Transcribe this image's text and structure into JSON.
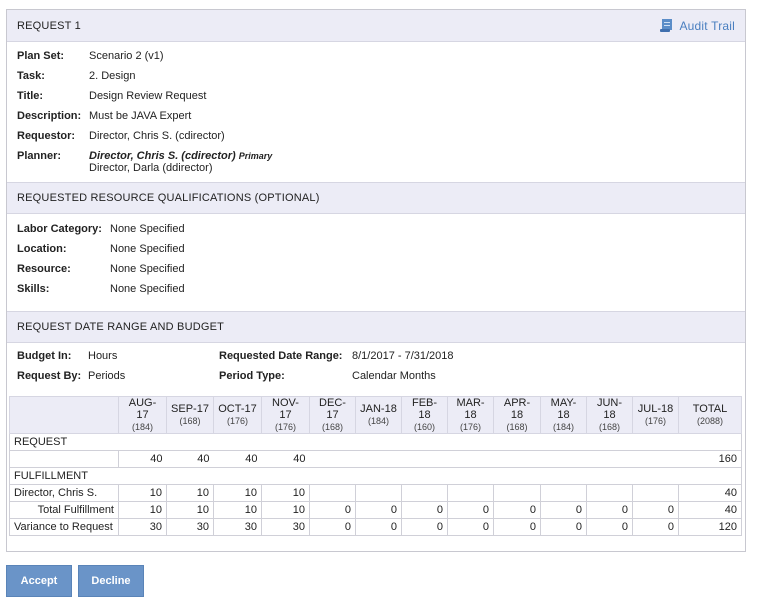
{
  "request": {
    "title": "REQUEST 1",
    "audit_trail": "Audit Trail",
    "fields": [
      {
        "label": "Plan Set:",
        "value": "Scenario 2 (v1)"
      },
      {
        "label": "Task:",
        "value": "2. Design"
      },
      {
        "label": "Title:",
        "value": "Design Review Request"
      },
      {
        "label": "Description:",
        "value": "Must be JAVA Expert"
      },
      {
        "label": "Requestor:",
        "value": "Director, Chris S. (cdirector)"
      }
    ],
    "planner": {
      "label": "Planner:",
      "primary_name": "Director, Chris S. (cdirector)",
      "primary_tag": "Primary",
      "secondary_name": "Director, Darla (ddirector)"
    }
  },
  "qualifications": {
    "title": "REQUESTED RESOURCE QUALIFICATIONS (OPTIONAL)",
    "fields": [
      {
        "label": "Labor Category:",
        "value": "None Specified"
      },
      {
        "label": "Location:",
        "value": "None Specified"
      },
      {
        "label": "Resource:",
        "value": "None Specified"
      },
      {
        "label": "Skills:",
        "value": "None Specified"
      }
    ]
  },
  "budget": {
    "title": "REQUEST DATE RANGE AND BUDGET",
    "budget_in_label": "Budget In:",
    "budget_in_value": "Hours",
    "request_by_label": "Request By:",
    "request_by_value": "Periods",
    "date_range_label": "Requested Date Range:",
    "date_range_value": "8/1/2017 - 7/31/2018",
    "period_type_label": "Period Type:",
    "period_type_value": "Calendar Months"
  },
  "grid": {
    "columns": [
      {
        "month": "AUG-17",
        "hours": "(184)"
      },
      {
        "month": "SEP-17",
        "hours": "(168)"
      },
      {
        "month": "OCT-17",
        "hours": "(176)"
      },
      {
        "month": "NOV-17",
        "hours": "(176)"
      },
      {
        "month": "DEC-17",
        "hours": "(168)"
      },
      {
        "month": "JAN-18",
        "hours": "(184)"
      },
      {
        "month": "FEB-18",
        "hours": "(160)"
      },
      {
        "month": "MAR-18",
        "hours": "(176)"
      },
      {
        "month": "APR-18",
        "hours": "(168)"
      },
      {
        "month": "MAY-18",
        "hours": "(184)"
      },
      {
        "month": "JUN-18",
        "hours": "(168)"
      },
      {
        "month": "JUL-18",
        "hours": "(176)"
      },
      {
        "month": "TOTAL",
        "hours": "(2088)"
      }
    ],
    "request_section": "REQUEST",
    "request_values": [
      "40",
      "40",
      "40",
      "40",
      "",
      "",
      "",
      "",
      "",
      "",
      "",
      "",
      "160"
    ],
    "fulfillment_section": "FULFILLMENT",
    "rows": [
      {
        "label": "Director, Chris S.",
        "values": [
          "10",
          "10",
          "10",
          "10",
          "",
          "",
          "",
          "",
          "",
          "",
          "",
          "",
          "40"
        ]
      },
      {
        "label": "Total Fulfillment",
        "values": [
          "10",
          "10",
          "10",
          "10",
          "0",
          "0",
          "0",
          "0",
          "0",
          "0",
          "0",
          "0",
          "40"
        ]
      },
      {
        "label": "Variance to Request",
        "values": [
          "30",
          "30",
          "30",
          "30",
          "0",
          "0",
          "0",
          "0",
          "0",
          "0",
          "0",
          "0",
          "120"
        ]
      }
    ]
  },
  "actions": {
    "accept": "Accept",
    "decline": "Decline"
  },
  "colors": {
    "header_bg": "#ececf6",
    "button_bg": "#6a94c8",
    "link": "#4a7fc0"
  }
}
